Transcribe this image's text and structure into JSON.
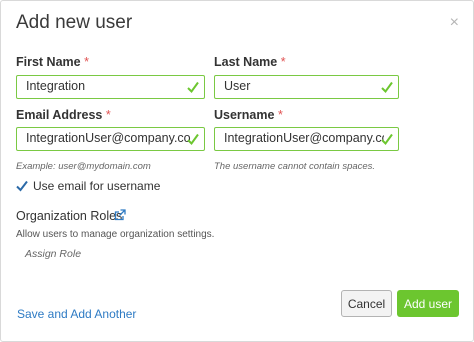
{
  "dialog": {
    "title": "Add new user",
    "close_icon": "close-icon",
    "close_glyph": "×"
  },
  "form": {
    "first_name": {
      "label": "First Name",
      "required_mark": "*",
      "value": "Integration",
      "valid_icon": "check-icon"
    },
    "last_name": {
      "label": "Last Name",
      "required_mark": "*",
      "value": "User",
      "valid_icon": "check-icon"
    },
    "email": {
      "label": "Email Address",
      "required_mark": "*",
      "value": "IntegrationUser@company.com",
      "hint": "Example: user@mydomain.com",
      "valid_icon": "check-icon"
    },
    "username": {
      "label": "Username",
      "required_mark": "*",
      "value": "IntegrationUser@company.com",
      "hint": "The username cannot contain spaces.",
      "valid_icon": "check-icon"
    },
    "use_email_checkbox": {
      "label": "Use email for username",
      "checked": true
    }
  },
  "org_roles": {
    "title": "Organization Roles",
    "link_icon": "external-link-icon",
    "description": "Allow users to manage organization settings.",
    "assign_placeholder": "Assign Role"
  },
  "footer": {
    "save_another_label": "Save and Add Another",
    "cancel_label": "Cancel",
    "add_label": "Add user"
  },
  "colors": {
    "valid_green": "#7ac943",
    "primary_button": "#6cc62f",
    "link_blue": "#2e7bc4",
    "required_red": "#e05252"
  }
}
